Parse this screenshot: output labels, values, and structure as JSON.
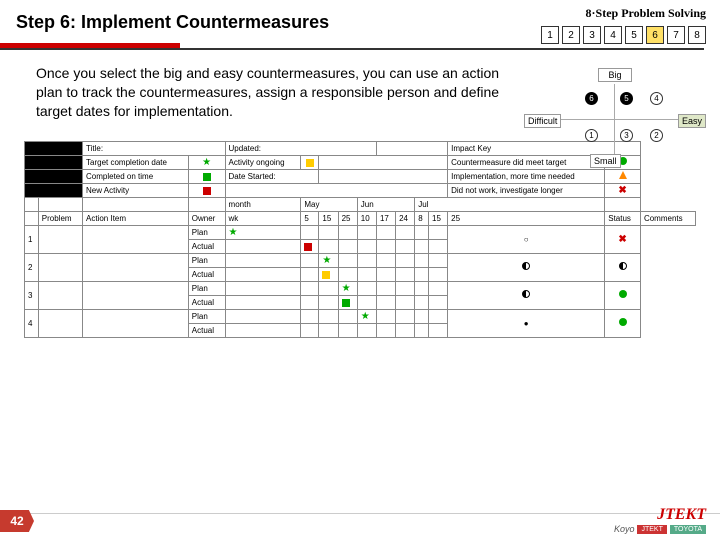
{
  "header": {
    "title": "Step 6: Implement Countermeasures",
    "logo": "8·Step Problem Solving"
  },
  "steps": [
    "1",
    "2",
    "3",
    "4",
    "5",
    "6",
    "7",
    "8"
  ],
  "active_step": 6,
  "body": "Once you select the big and easy countermeasures, you can use an action plan to track the countermeasures, assign a responsible person and define target dates for implementation.",
  "quad": {
    "top": "Big",
    "left": "Difficult",
    "right": "Easy",
    "bottom": "Small",
    "c": [
      "6",
      "5",
      "4",
      "1",
      "3",
      "2"
    ]
  },
  "plan": {
    "title": "Title:",
    "updated": "Updated:",
    "impact_key": "Impact Key",
    "legend": {
      "tcd": "Target completion date",
      "cot": "Completed on time",
      "nla": "New Activity",
      "ao": "Activity ongoing",
      "ds": "Date Started:"
    },
    "impact": {
      "i1": "Countermeasure did meet target",
      "i2": "Implementation, more time needed",
      "i3": "Did not work, investigate longer"
    },
    "months": [
      "month",
      "May",
      "Jun",
      "Jul"
    ],
    "cols": [
      "Problem",
      "Action Item",
      "Owner"
    ],
    "status": "Status",
    "comments": "Comments",
    "rows": [
      "1",
      "2",
      "3",
      "4"
    ],
    "pa": {
      "plan": "Plan",
      "actual": "Actual"
    }
  },
  "footer": {
    "page": "42",
    "brand": "JTEKT",
    "sub": "Koyo",
    "tag1": "JTEKT",
    "tag2": "TOYOTA"
  }
}
